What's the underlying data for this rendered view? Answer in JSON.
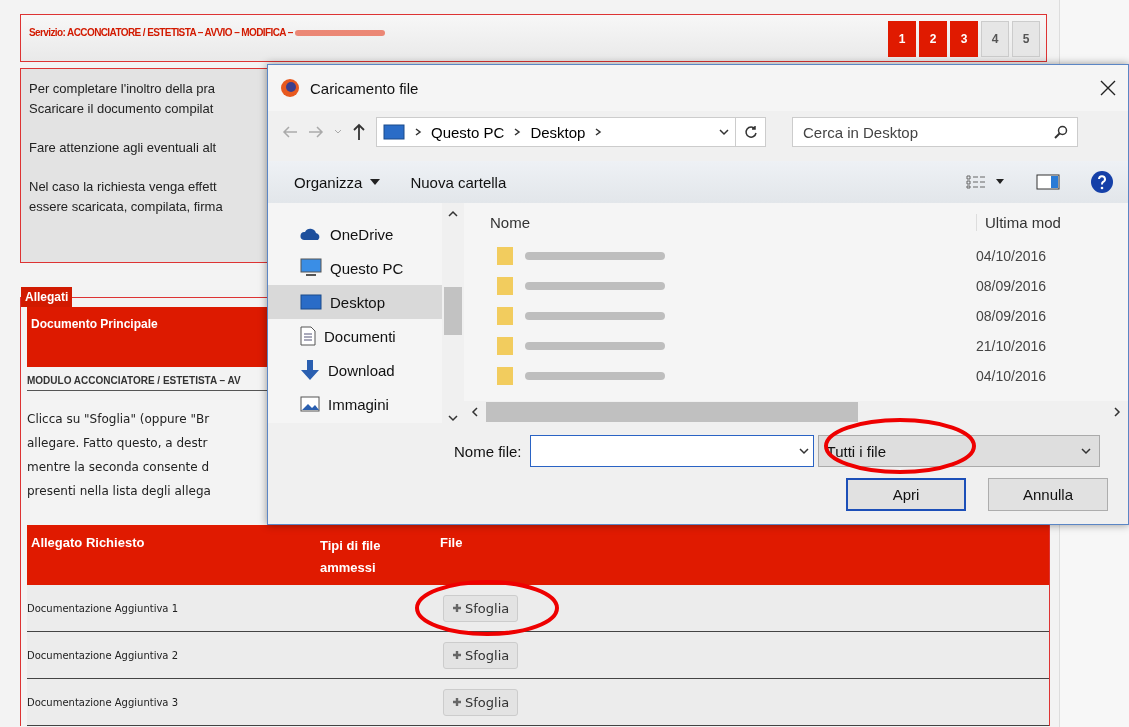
{
  "header": {
    "service": "Servizio: ACCONCIATORE / ESTETISTA – AVVIO – MODIFICA –",
    "steps": [
      {
        "label": "1",
        "done": true
      },
      {
        "label": "2",
        "done": true
      },
      {
        "label": "3",
        "done": true
      },
      {
        "label": "4",
        "done": false
      },
      {
        "label": "5",
        "done": false
      }
    ]
  },
  "info": {
    "paragraphs": [
      [
        "Per completare l'inoltro della pra",
        "Scaricare il documento compilat"
      ],
      [
        "Fare attenzione agli eventuali alt"
      ],
      [
        "Nel caso la richiesta venga effett",
        "essere scaricata, compilata, firma"
      ]
    ]
  },
  "attachments": {
    "legend": "Allegati",
    "main_heading": "Documento Principale",
    "module": "MODULO ACCONCIATORE / ESTETISTA – AV",
    "instructions": [
      "Clicca su \"Sfoglia\" (oppure \"Br",
      "allegare. Fatto questo, a destr",
      "mentre la seconda consente d",
      "presenti nella lista degli allega"
    ],
    "table": {
      "columns": [
        "Allegato Richiesto",
        "Tipi di file ammessi",
        "File"
      ],
      "rows": [
        {
          "name": "Documentazione Aggiuntiva 1",
          "button": "Sfoglia"
        },
        {
          "name": "Documentazione Aggiuntiva 2",
          "button": "Sfoglia"
        },
        {
          "name": "Documentazione Aggiuntiva 3",
          "button": "Sfoglia"
        }
      ]
    }
  },
  "dialog": {
    "title": "Caricamento file",
    "path": [
      "Questo PC",
      "Desktop"
    ],
    "search": {
      "placeholder": "Cerca in Desktop"
    },
    "toolbar": [
      "Organizza",
      "Nuova cartella"
    ],
    "nav": [
      {
        "label": "OneDrive",
        "kind": "cloud",
        "selected": false
      },
      {
        "label": "Questo PC",
        "kind": "pc",
        "selected": false
      },
      {
        "label": "Desktop",
        "kind": "desktop",
        "selected": true
      },
      {
        "label": "Documenti",
        "kind": "document",
        "selected": false
      },
      {
        "label": "Download",
        "kind": "download",
        "selected": false
      },
      {
        "label": "Immagini",
        "kind": "image",
        "selected": false
      }
    ],
    "columns": [
      "Nome",
      "Ultima mod"
    ],
    "files": [
      {
        "modified": "04/10/2016"
      },
      {
        "modified": "08/09/2016"
      },
      {
        "modified": "08/09/2016"
      },
      {
        "modified": "21/10/2016"
      },
      {
        "modified": "04/10/2016"
      }
    ],
    "filename": {
      "label": "Nome file:"
    },
    "filter": "Tutti i file",
    "buttons": [
      "Apri",
      "Annulla"
    ]
  }
}
